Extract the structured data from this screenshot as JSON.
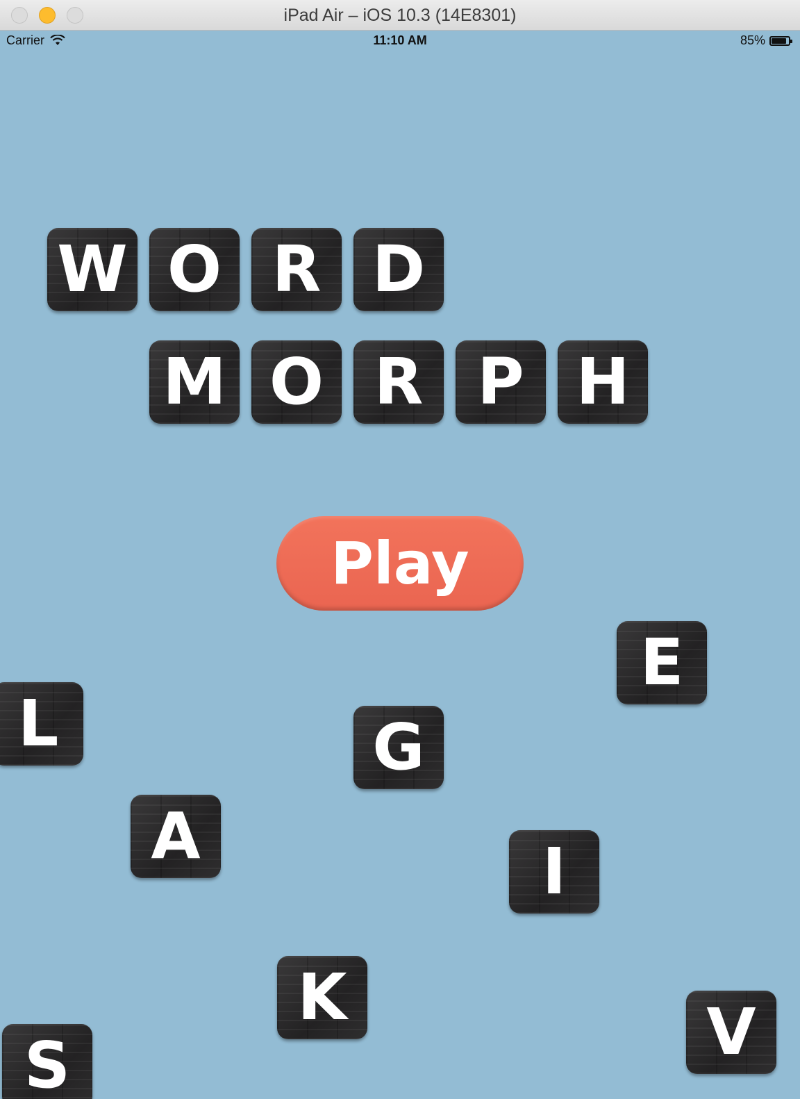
{
  "window": {
    "title": "iPad Air – iOS 10.3 (14E8301)"
  },
  "status_bar": {
    "carrier": "Carrier",
    "time": "11:10 AM",
    "battery": "85%",
    "wifi_icon": "wifi-icon",
    "battery_icon": "battery-icon",
    "battery_level": 0.85
  },
  "colors": {
    "background": "#93bcd4",
    "tile": "#2b2a2b",
    "tile_text": "#ffffff",
    "play_button": "#ee6a55"
  },
  "title_word1": [
    "W",
    "O",
    "R",
    "D"
  ],
  "title_word2": [
    "M",
    "O",
    "R",
    "P",
    "H"
  ],
  "play_label": "Play",
  "floating_tiles": [
    "E",
    "L",
    "G",
    "A",
    "I",
    "K",
    "V",
    "S"
  ]
}
